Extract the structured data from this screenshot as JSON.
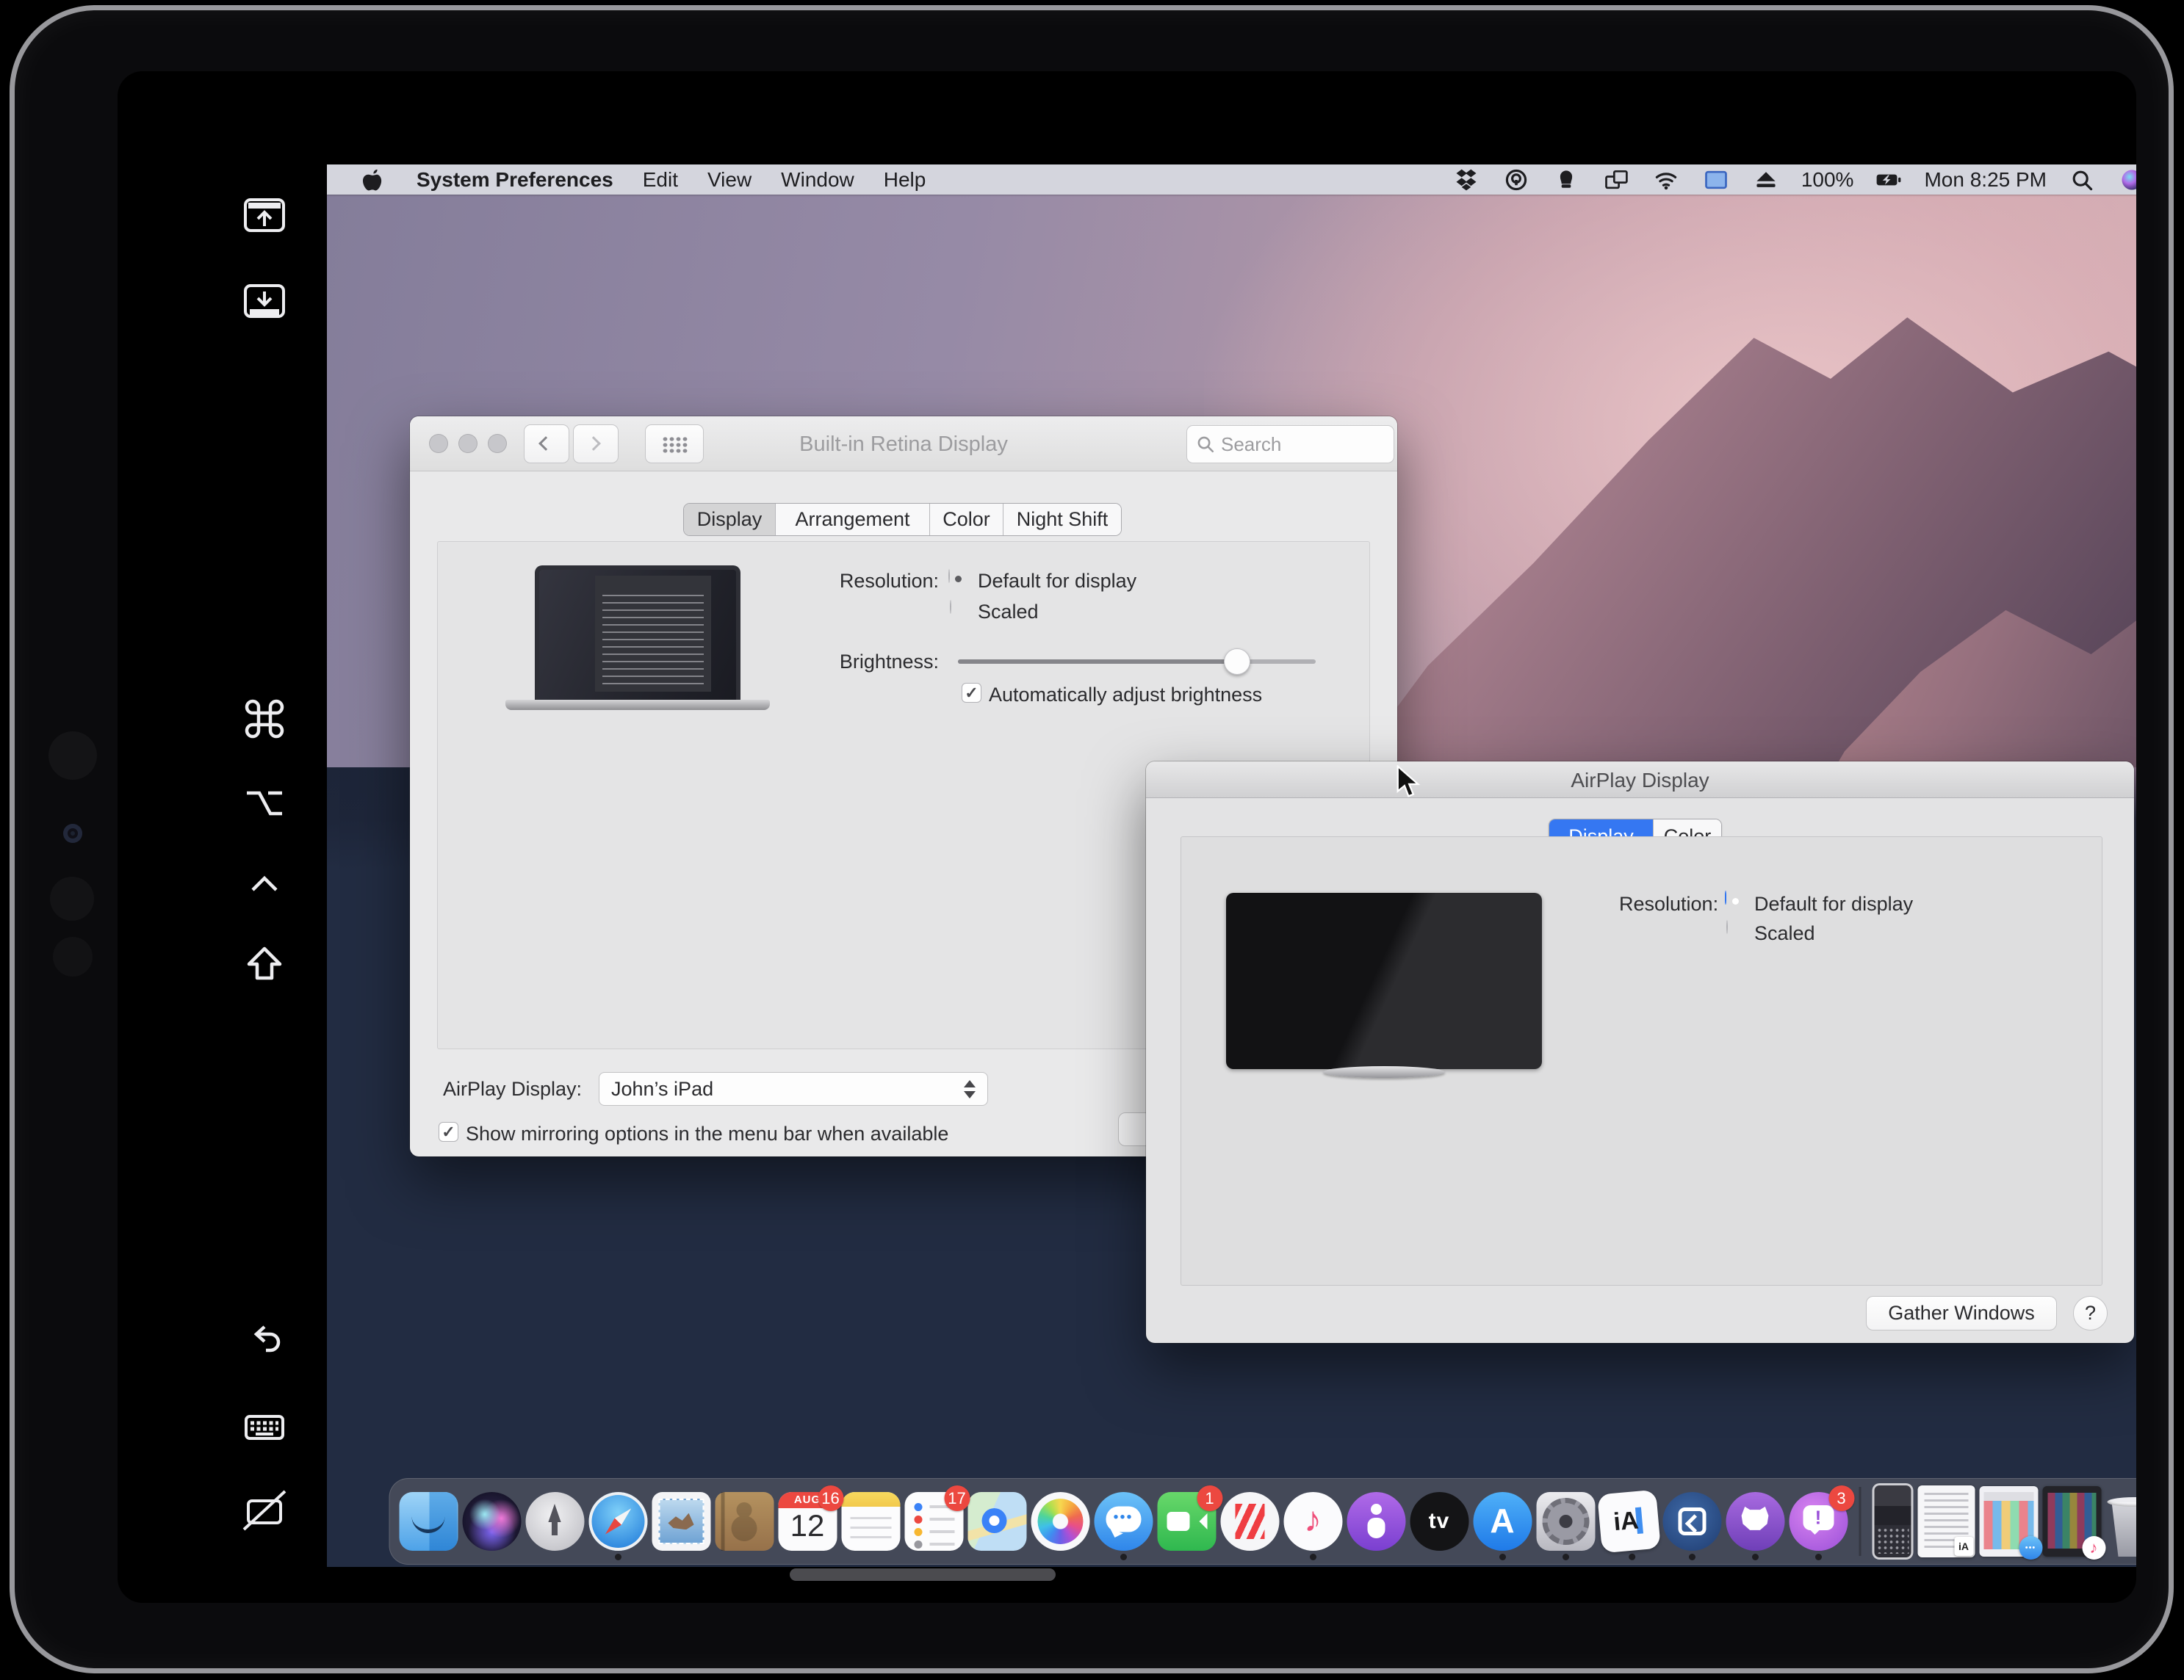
{
  "menu_bar": {
    "app_name": "System Preferences",
    "menus": [
      "Edit",
      "View",
      "Window",
      "Help"
    ],
    "status": {
      "battery_percent": "100%",
      "clock": "Mon 8:25 PM"
    },
    "status_icons": [
      "dropbox-icon",
      "onepassword-icon",
      "silhouette-icon",
      "sidecar-windows-icon",
      "wifi-icon",
      "display-active-icon",
      "eject-icon",
      "battery-charging-icon",
      "spotlight-icon",
      "siri-icon",
      "notification-center-icon"
    ]
  },
  "prefs_window": {
    "title": "Built-in Retina Display",
    "search_placeholder": "Search",
    "tabs": [
      "Display",
      "Arrangement",
      "Color",
      "Night Shift"
    ],
    "selected_tab": "Display",
    "resolution_label": "Resolution:",
    "resolution_options": [
      "Default for display",
      "Scaled"
    ],
    "resolution_selected": "Default for display",
    "brightness_label": "Brightness:",
    "brightness_percent": 78,
    "auto_brightness_label": "Automatically adjust brightness",
    "auto_brightness_checked": true,
    "airplay_label": "AirPlay Display:",
    "airplay_value": "John’s iPad",
    "mirroring_label": "Show mirroring options in the menu bar when available",
    "mirroring_checked": true
  },
  "airplay_window": {
    "title": "AirPlay Display",
    "tabs": [
      "Display",
      "Color"
    ],
    "selected_tab": "Display",
    "resolution_label": "Resolution:",
    "resolution_options": [
      "Default for display",
      "Scaled"
    ],
    "resolution_selected": "Default for display",
    "gather_windows_label": "Gather Windows",
    "help_label": "?"
  },
  "glyphs": {
    "check": "✓"
  },
  "accent_colors": {
    "selection_blue": "#3577f2",
    "badge_red": "#ec4840"
  },
  "sidecar_sidebar": {
    "icons": [
      "menubar-toggle-icon",
      "dock-toggle-icon",
      "command-key-icon",
      "option-key-icon",
      "control-key-icon",
      "shift-key-icon",
      "undo-icon",
      "keyboard-icon",
      "disconnect-icon"
    ]
  },
  "dock": {
    "items": [
      {
        "icon": "finder",
        "running": true
      },
      {
        "icon": "siri"
      },
      {
        "icon": "launchpad"
      },
      {
        "icon": "safari",
        "running": true
      },
      {
        "icon": "mail"
      },
      {
        "icon": "contacts"
      },
      {
        "icon": "calendar",
        "badge": "16",
        "glyph": "AUG",
        "glyph2": "12"
      },
      {
        "icon": "notes"
      },
      {
        "icon": "reminders",
        "badge": "17"
      },
      {
        "icon": "maps"
      },
      {
        "icon": "photos"
      },
      {
        "icon": "messages",
        "glyph": "•••",
        "running": true
      },
      {
        "icon": "facetime",
        "badge": "1"
      },
      {
        "icon": "news",
        "running": true
      },
      {
        "icon": "music",
        "glyph": "♪",
        "running": true
      },
      {
        "icon": "podcasts"
      },
      {
        "icon": "tv",
        "glyph": "tv"
      },
      {
        "icon": "appstore",
        "glyph": "A",
        "running": true
      },
      {
        "icon": "sysprefs",
        "running": true
      },
      {
        "icon": "iawriter",
        "glyph": "iA",
        "running": true
      },
      {
        "icon": "sidecar",
        "running": true
      },
      {
        "icon": "github",
        "running": true
      },
      {
        "icon": "beta",
        "glyph": "!",
        "badge": "3",
        "running": true
      },
      {
        "type": "separator"
      },
      {
        "icon": "min-phone"
      },
      {
        "icon": "min-doc",
        "glyph": "iA"
      },
      {
        "icon": "min-browser",
        "glyph": "•••"
      },
      {
        "icon": "min-grid",
        "glyph": "♪"
      },
      {
        "icon": "trash"
      }
    ]
  }
}
